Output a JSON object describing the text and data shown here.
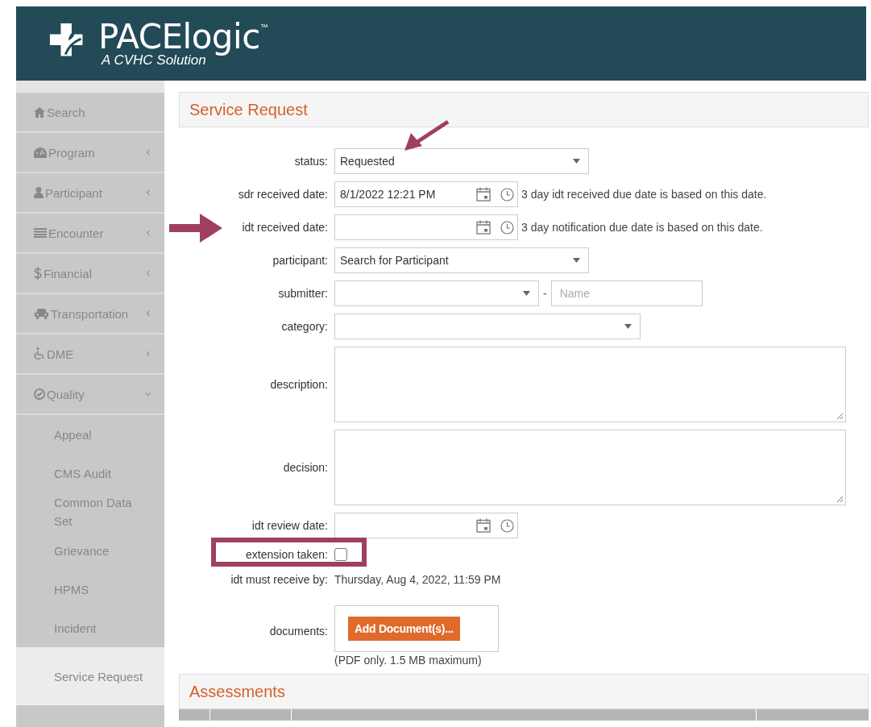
{
  "header": {
    "brand": "PACElogic",
    "trademark": "™",
    "tagline": "A CVHC Solution"
  },
  "sidebar": {
    "items": [
      {
        "kind": "link",
        "label": "Search"
      },
      {
        "kind": "group",
        "label": "Program",
        "expanded": false
      },
      {
        "kind": "group",
        "label": "Participant",
        "expanded": false
      },
      {
        "kind": "group",
        "label": "Encounter",
        "expanded": false
      },
      {
        "kind": "group",
        "label": "Financial",
        "expanded": false
      },
      {
        "kind": "group",
        "label": "Transportation",
        "expanded": false
      },
      {
        "kind": "group",
        "label": "DME",
        "expanded": false
      },
      {
        "kind": "group",
        "label": "Quality",
        "expanded": true,
        "children": [
          {
            "label": "Appeal",
            "selected": false
          },
          {
            "label": "CMS Audit",
            "selected": false
          },
          {
            "label": "Common Data Set",
            "selected": false
          },
          {
            "label": "Grievance",
            "selected": false
          },
          {
            "label": "HPMS",
            "selected": false
          },
          {
            "label": "Incident",
            "selected": false
          },
          {
            "label": "Service Request",
            "selected": true
          }
        ]
      }
    ]
  },
  "form": {
    "title": "Service Request",
    "fields": [
      {
        "kind": "select",
        "label": "status:",
        "value": "Requested",
        "marked": true
      },
      {
        "kind": "datetime",
        "label": "sdr received date:",
        "value": "8/1/2022 12:21 PM",
        "note": "3 day idt received due date is based on this date."
      },
      {
        "kind": "datetime",
        "label": "idt received date:",
        "note": "3 day notification due date is based on this date.",
        "marked": true
      },
      {
        "kind": "select",
        "label": "participant:",
        "value": "Search for Participant"
      },
      {
        "kind": "select-name",
        "label": "submitter:",
        "separator": "-",
        "placeholder": "Name"
      },
      {
        "kind": "select",
        "label": "category:"
      },
      {
        "kind": "textarea",
        "label": "description:"
      },
      {
        "kind": "textarea",
        "label": "decision:"
      },
      {
        "kind": "datetime",
        "label": "idt review date:"
      },
      {
        "kind": "checkbox",
        "label": "extension taken:",
        "checked": false,
        "marked": true
      },
      {
        "kind": "readonly",
        "label": "idt must receive by:",
        "value": "Thursday, Aug 4, 2022, 11:59 PM"
      },
      {
        "kind": "upload",
        "label": "documents:",
        "button": "Add Document(s)...",
        "note": "(PDF only. 1.5 MB maximum)"
      }
    ]
  },
  "assessments": {
    "title": "Assessments"
  }
}
